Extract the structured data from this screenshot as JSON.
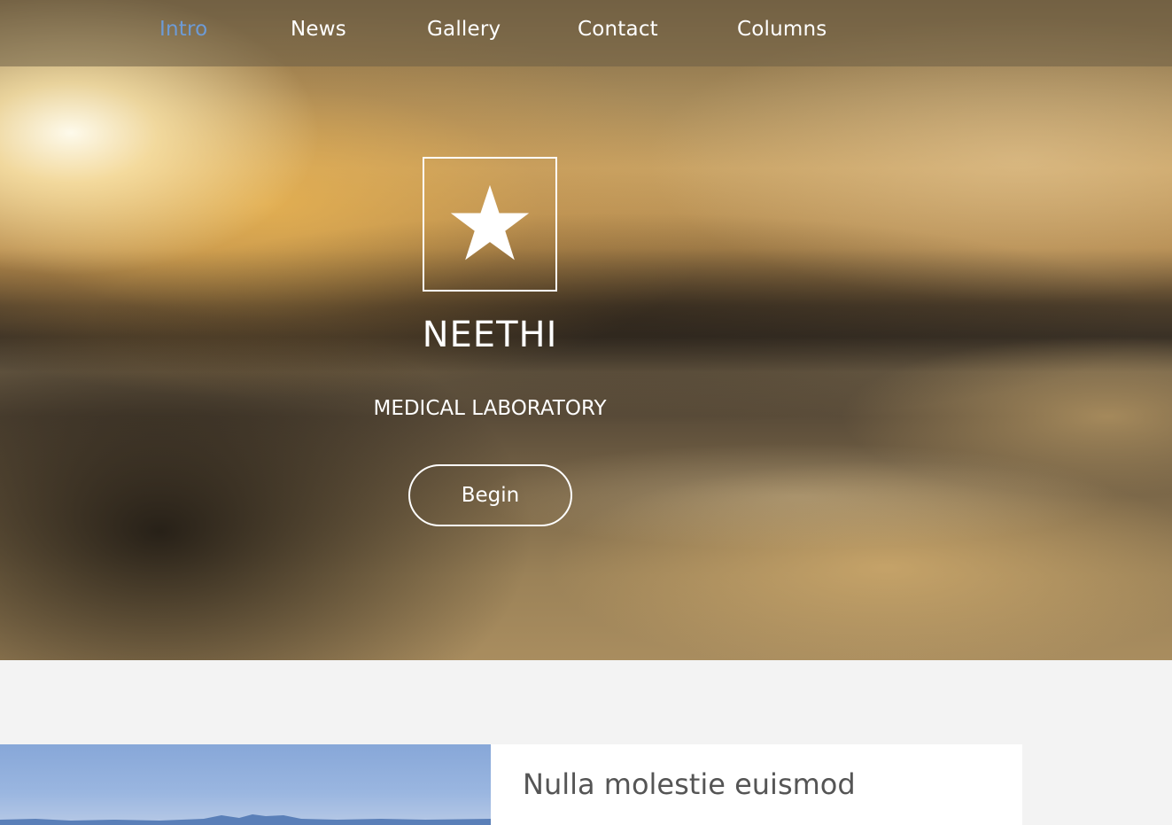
{
  "nav": {
    "items": [
      {
        "label": "Intro",
        "active": true
      },
      {
        "label": "News",
        "active": false
      },
      {
        "label": "Gallery",
        "active": false
      },
      {
        "label": "Contact",
        "active": false
      },
      {
        "label": "Columns",
        "active": false
      }
    ]
  },
  "hero": {
    "logo_icon": "star-icon",
    "title": "NEETHI",
    "subtitle": "MEDICAL LABORATORY",
    "button_label": "Begin"
  },
  "section": {
    "card_title": "Nulla molestie euismod"
  },
  "colors": {
    "nav_active": "#6d9bd6",
    "nav_text": "#ffffff",
    "page_bg": "#f3f3f3"
  }
}
